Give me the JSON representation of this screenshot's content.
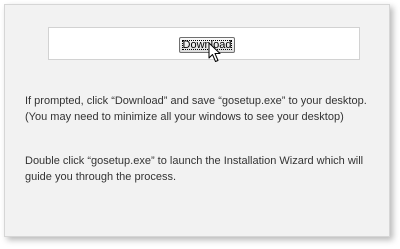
{
  "download": {
    "button_label": "Download"
  },
  "instructions": {
    "step1": "If prompted, click “Download” and save “gosetup.exe” to your desktop. (You may need to minimize all your windows to see your desktop)",
    "step2": "Double click “gosetup.exe” to launch the Installation Wizard which will guide you through the process."
  },
  "icons": {
    "cursor": "mouse-pointer-icon"
  }
}
